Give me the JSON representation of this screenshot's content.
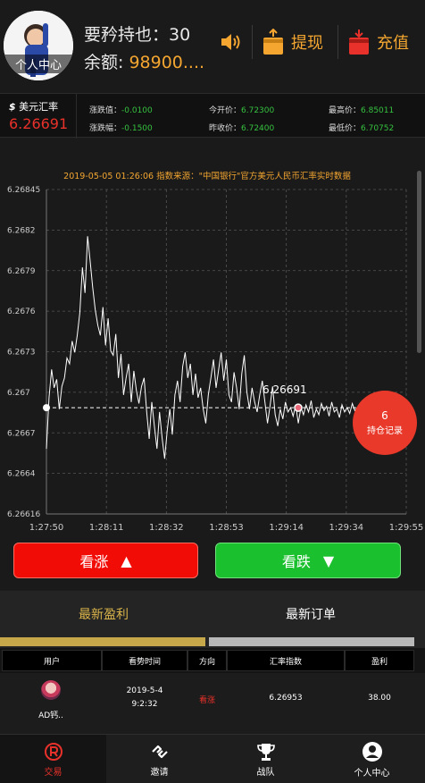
{
  "header": {
    "avatar_label": "个人中心",
    "username": "要矜持也：30",
    "balance_label": "余额:",
    "balance_value": "98900....",
    "withdraw_label": "提现",
    "deposit_label": "充值"
  },
  "quote": {
    "currency_symbol": "$",
    "currency_name": "美元汇率",
    "price": "6.26691",
    "change_value_label": "涨跌值：",
    "change_value": "-0.0100",
    "change_rate_label": "涨跌幅：",
    "change_rate": "-0.1500",
    "open_label": "今开价：",
    "open": "6.72300",
    "prev_close_label": "昨收价：",
    "prev_close": "6.72400",
    "high_label": "最高价：",
    "high": "6.85011",
    "low_label": "最低价：",
    "low": "6.70752"
  },
  "chart_data": {
    "type": "line",
    "title": "2019-05-05 01:26:06 指数来源：\"中国银行\"官方美元人民币汇率实时数据",
    "y_ticks": [
      "6.26845",
      "6.2682",
      "6.2679",
      "6.2676",
      "6.2673",
      "6.267",
      "6.2667",
      "6.2664",
      "6.26616"
    ],
    "x_ticks": [
      "1:27:50",
      "1:28:11",
      "1:28:32",
      "1:28:53",
      "1:29:14",
      "1:29:34",
      "1:29:55"
    ],
    "ylim": [
      6.26616,
      6.26845
    ],
    "current_label": "6.26691",
    "current_value": 6.26691,
    "x": [
      0,
      1,
      2,
      3,
      4,
      5,
      6,
      7,
      8,
      9,
      10,
      11,
      12,
      13,
      14,
      15,
      16,
      17,
      18,
      19,
      20,
      21,
      22,
      23,
      24,
      25,
      26,
      27,
      28,
      29,
      30,
      31,
      32,
      33,
      34,
      35,
      36,
      37,
      38,
      39,
      40,
      41,
      42,
      43,
      44,
      45,
      46,
      47,
      48,
      49,
      50,
      51,
      52,
      53,
      54,
      55,
      56,
      57,
      58,
      59,
      60,
      61,
      62,
      63,
      64,
      65,
      66,
      67,
      68,
      69,
      70,
      71,
      72,
      73,
      74,
      75,
      76,
      77,
      78,
      79,
      80,
      81,
      82,
      83,
      84,
      85,
      86,
      87,
      88,
      89,
      90,
      91,
      92,
      93,
      94,
      95,
      96,
      97,
      98,
      99,
      100,
      101,
      102,
      103,
      104,
      105,
      106,
      107,
      108,
      109,
      110,
      111,
      112,
      113,
      114,
      115,
      116,
      117,
      118,
      119,
      120,
      121,
      122,
      123,
      124,
      125,
      126,
      127,
      128,
      129,
      130,
      131,
      132,
      133,
      134,
      135,
      136,
      137,
      138,
      139,
      140
    ],
    "values": [
      6.26662,
      6.26698,
      6.26718,
      6.26705,
      6.26711,
      6.2669,
      6.26706,
      6.26712,
      6.26726,
      6.26722,
      6.26738,
      6.2673,
      6.26742,
      6.26758,
      6.2679,
      6.26772,
      6.26812,
      6.26795,
      6.26776,
      6.2676,
      6.26749,
      6.26742,
      6.26762,
      6.26735,
      6.26754,
      6.26731,
      6.26728,
      6.26743,
      6.26712,
      6.26729,
      6.267,
      6.26712,
      6.26722,
      6.26695,
      6.26717,
      6.26703,
      6.26694,
      6.26706,
      6.26712,
      6.26688,
      6.26669,
      6.26695,
      6.26678,
      6.26662,
      6.26688,
      6.2667,
      6.26655,
      6.26675,
      6.2669,
      6.26672,
      6.267,
      6.2671,
      6.26695,
      6.2672,
      6.2673,
      6.26712,
      6.26722,
      6.267,
      6.26715,
      6.26698,
      6.26705,
      6.2669,
      6.2668,
      6.267,
      6.26712,
      6.26725,
      6.26705,
      6.26718,
      6.2673,
      6.2671,
      6.26725,
      6.267,
      6.26695,
      6.26716,
      6.26705,
      6.2669,
      6.26715,
      6.26728,
      6.26702,
      6.2669,
      6.26705,
      6.26695,
      6.26688,
      6.267,
      6.2671,
      6.26695,
      6.2668,
      6.26692,
      6.26706,
      6.26686,
      6.26678,
      6.2669,
      6.26683,
      6.26695,
      6.26688,
      6.26691,
      6.26685,
      6.26693,
      6.2668,
      6.26691,
      6.26686,
      6.26693,
      6.26688,
      6.26696,
      6.26684,
      6.2669,
      6.26686,
      6.26694,
      6.26689,
      6.26692,
      6.26685,
      6.26695,
      6.26688,
      6.2669,
      6.26684,
      6.26693,
      6.26688,
      6.26691,
      6.26687,
      6.26694,
      6.26689,
      6.26691,
      6.26686,
      6.26692,
      6.26688,
      6.2669,
      6.26685,
      6.26693,
      6.26688,
      6.26691,
      6.26687,
      6.26694,
      6.26689,
      6.26691,
      6.26686,
      6.26692,
      6.26688,
      6.2669,
      6.26685,
      6.26693,
      6.26691
    ]
  },
  "floating_badge": {
    "count": "6",
    "label": "持仓记录"
  },
  "trade": {
    "up_label": "看涨",
    "down_label": "看跌"
  },
  "tabs": {
    "profit": "最新盈利",
    "orders": "最新订单"
  },
  "table": {
    "headers": [
      "用户",
      "看势时间",
      "方向",
      "汇率指数",
      "盈利"
    ],
    "rows": [
      {
        "user": "AD钙..",
        "date": "2019-5-4",
        "time": "9:2:32",
        "direction": "看涨",
        "rate": "6.26953",
        "profit": "38.00"
      }
    ]
  },
  "nav": {
    "items": [
      {
        "label": "交易",
        "icon": "registered-icon"
      },
      {
        "label": "邀请",
        "icon": "link-icon"
      },
      {
        "label": "战队",
        "icon": "trophy-icon"
      },
      {
        "label": "个人中心",
        "icon": "user-icon"
      }
    ]
  },
  "colors": {
    "up": "#f10c06",
    "down": "#1ac02d",
    "accent": "#f4a630",
    "price": "#e8312a"
  }
}
